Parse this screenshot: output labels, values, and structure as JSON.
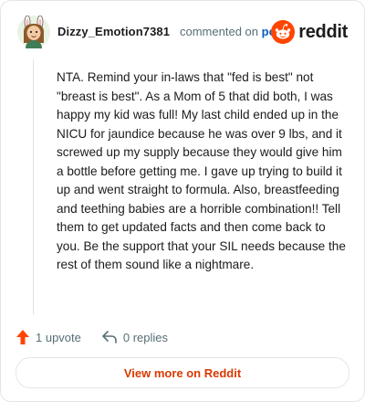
{
  "header": {
    "username": "Dizzy_Emotion7381",
    "commented_text": "commented on",
    "post_link": "post",
    "logo_text": "reddit"
  },
  "comment": {
    "body": "NTA. Remind your in-laws that \"fed is best\" not \"breast is best\". As a Mom of 5 that did both, I was happy my kid was full! My last child ended up in the NICU for jaundice because he was over 9 lbs, and it screwed up my supply because they would give him a bottle before getting me. I gave up trying to build it up and went straight to formula. Also, breastfeeding and teething babies are a horrible combination!! Tell them to get updated facts and then come back to you. Be the support that your SIL needs because the rest of them sound like a nightmare."
  },
  "actions": {
    "upvotes": "1 upvote",
    "replies": "0 replies"
  },
  "footer": {
    "view_more": "View more on Reddit"
  },
  "colors": {
    "reddit_orange": "#ff4500",
    "upvote_orange": "#ff4500",
    "link_blue": "#0a5fbd",
    "view_more_text": "#d93a00"
  },
  "icons": {
    "avatar": "user-avatar",
    "logo": "reddit-snoo-icon",
    "upvote": "upvote-arrow-icon",
    "reply": "reply-arrow-icon"
  }
}
